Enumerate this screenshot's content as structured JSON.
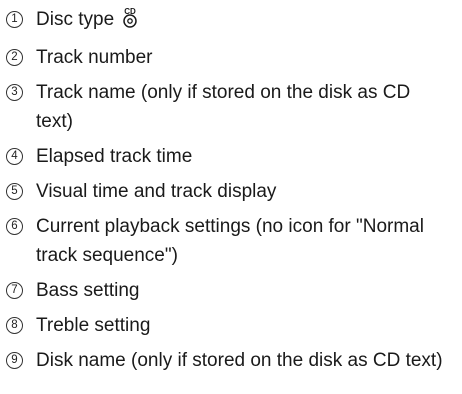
{
  "legend": {
    "items": [
      {
        "number": "1",
        "text": "Disc type"
      },
      {
        "number": "2",
        "text": "Track number"
      },
      {
        "number": "3",
        "text": "Track name (only if stored on the disk as CD text)"
      },
      {
        "number": "4",
        "text": "Elapsed track time"
      },
      {
        "number": "5",
        "text": "Visual time and track display"
      },
      {
        "number": "6",
        "text": "Current playback settings (no icon for \"Normal track sequence\")"
      },
      {
        "number": "7",
        "text": "Bass setting"
      },
      {
        "number": "8",
        "text": "Treble setting"
      },
      {
        "number": "9",
        "text": "Disk name (only if stored on the disk as CD text)"
      }
    ],
    "disc_icon": {
      "name": "cd-disc-icon",
      "label": "CD"
    }
  }
}
